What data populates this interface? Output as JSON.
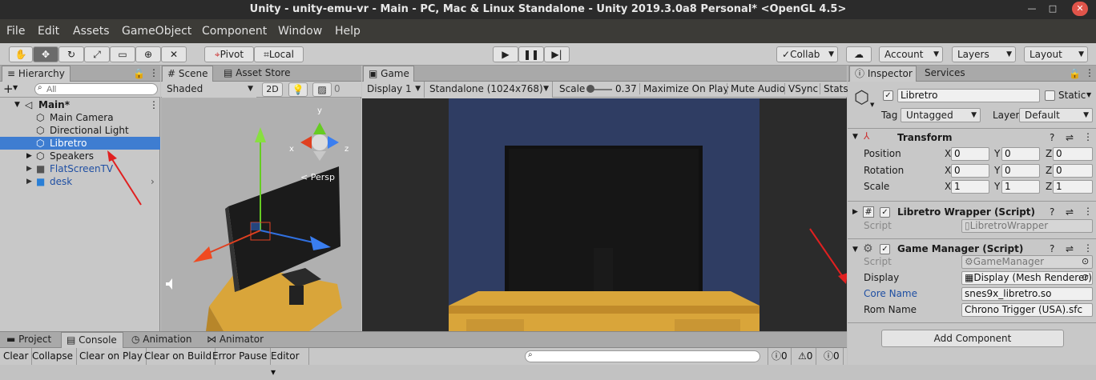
{
  "window": {
    "title": "Unity - unity-emu-vr - Main - PC, Mac & Linux Standalone - Unity 2019.3.0a8 Personal* <OpenGL 4.5>"
  },
  "menu": [
    "File",
    "Edit",
    "Assets",
    "GameObject",
    "Component",
    "Window",
    "Help"
  ],
  "toolbar": {
    "pivot": "Pivot",
    "local": "Local",
    "collab": "Collab",
    "account": "Account",
    "layers": "Layers",
    "layout": "Layout"
  },
  "hierarchy": {
    "tab": "Hierarchy",
    "search_placeholder": "All",
    "scene": "Main*",
    "items": [
      "Main Camera",
      "Directional Light",
      "Libretro",
      "Speakers",
      "FlatScreenTV",
      "desk"
    ]
  },
  "scene_view": {
    "tab_scene": "Scene",
    "tab_store": "Asset Store",
    "shading": "Shaded",
    "mode": "2D",
    "gizmo_count": "0",
    "persp": "< Persp",
    "axis_y": "y",
    "axis_x": "x",
    "axis_z": "z"
  },
  "game_view": {
    "tab": "Game",
    "display": "Display 1",
    "resolution": "Standalone (1024x768)",
    "scale_label": "Scale",
    "scale_value": "0.37",
    "maximize": "Maximize On Play",
    "mute": "Mute Audio",
    "vsync": "VSync",
    "stats": "Stats"
  },
  "inspector": {
    "tab": "Inspector",
    "tab_services": "Services",
    "object_name": "Libretro",
    "static_label": "Static",
    "tag_label": "Tag",
    "tag_value": "Untagged",
    "layer_label": "Layer",
    "layer_value": "Default",
    "transform": {
      "title": "Transform",
      "position_label": "Position",
      "position": [
        "0",
        "0",
        "0"
      ],
      "rotation_label": "Rotation",
      "rotation": [
        "0",
        "0",
        "0"
      ],
      "scale_label": "Scale",
      "scale": [
        "1",
        "1",
        "1"
      ],
      "axes": [
        "X",
        "Y",
        "Z"
      ]
    },
    "libretro_wrapper": {
      "title": "Libretro Wrapper (Script)",
      "script_label": "Script",
      "script_value": "LibretroWrapper"
    },
    "game_manager": {
      "title": "Game Manager (Script)",
      "script_label": "Script",
      "script_value": "GameManager",
      "display_label": "Display",
      "display_value": "Display (Mesh Renderer)",
      "core_label": "Core Name",
      "core_value": "snes9x_libretro.so",
      "rom_label": "Rom Name",
      "rom_value": "Chrono Trigger (USA).sfc"
    },
    "add_component": "Add Component"
  },
  "bottom": {
    "tabs": [
      "Project",
      "Console",
      "Animation",
      "Animator"
    ],
    "buttons": [
      "Clear",
      "Collapse",
      "Clear on Play",
      "Clear on Build",
      "Error Pause",
      "Editor"
    ],
    "counts": [
      "0",
      "0",
      "0"
    ]
  },
  "colors": {
    "selection": "#3e7dd1",
    "title_bg": "#2b2b2b",
    "menu_bg": "#3c3b37",
    "game_bg": "#2e3a5c"
  }
}
